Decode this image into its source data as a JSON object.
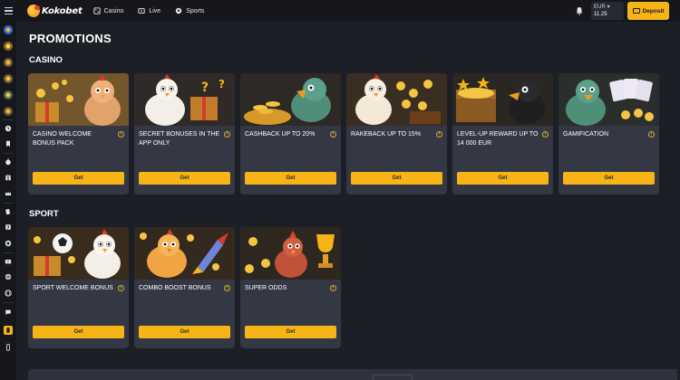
{
  "header": {
    "logo_text": "Kokobet",
    "nav": [
      {
        "label": "Casino",
        "icon": "casino-icon"
      },
      {
        "label": "Live",
        "icon": "live-icon"
      },
      {
        "label": "Sports",
        "icon": "sports-icon"
      }
    ],
    "balance": {
      "currency": "EUR",
      "amount": "11.25"
    },
    "deposit_label": "Deposit"
  },
  "page": {
    "title": "PROMOTIONS"
  },
  "sections": {
    "casino": {
      "title": "CASINO",
      "cards": [
        {
          "title": "CASINO WELCOME BONUS PACK",
          "button": "Get"
        },
        {
          "title": "SECRET BONUSES IN THE APP ONLY",
          "button": "Get"
        },
        {
          "title": "CASHBACK UP TO 20%",
          "button": "Get"
        },
        {
          "title": "RAKEBACK UP TO 15%",
          "button": "Get"
        },
        {
          "title": "LEVEL-UP REWARD UP TO 14 000 EUR",
          "button": "Get"
        },
        {
          "title": "GAMIFICATION",
          "button": "Get"
        }
      ]
    },
    "sport": {
      "title": "SPORT",
      "cards": [
        {
          "title": "SPORT WELCOME BONUS",
          "button": "Get"
        },
        {
          "title": "COMBO BOOST BONUS",
          "button": "Get"
        },
        {
          "title": "SUPER ODDS",
          "button": "Get"
        }
      ]
    }
  },
  "info_glyph": "i",
  "colors": {
    "background": "#1d1f26",
    "card": "#343844",
    "accent": "#f6b416",
    "topbar": "#15171d"
  }
}
